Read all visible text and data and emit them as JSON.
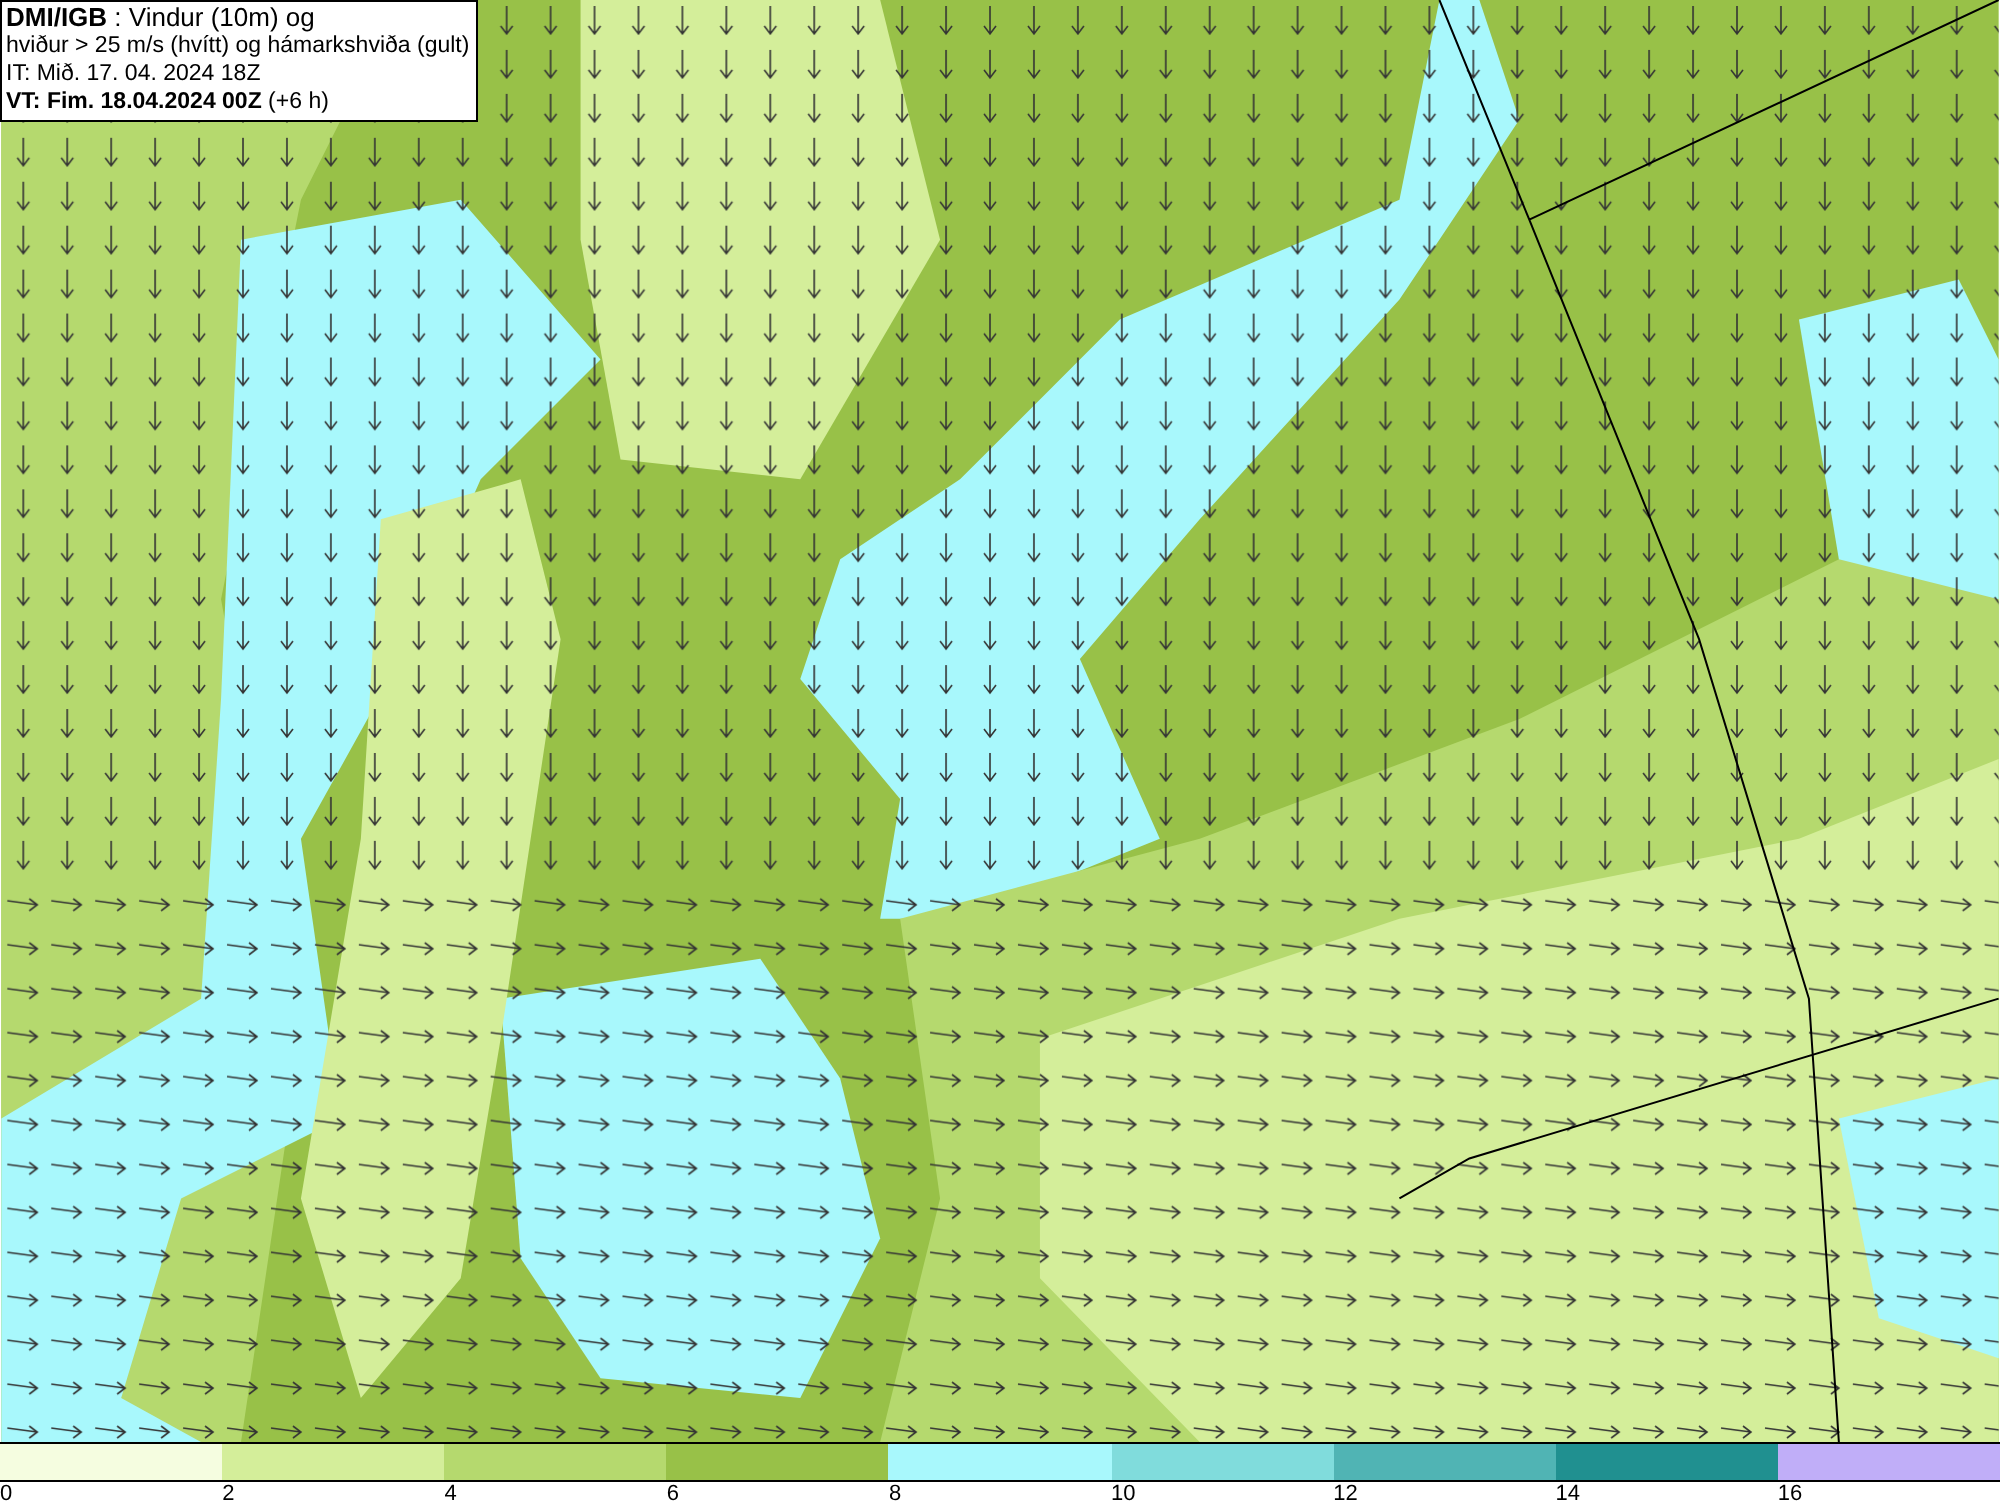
{
  "header": {
    "lines": [
      "**DMI/IGB** : Vindur (10m) og",
      "hviður > 25 m/s (hvítt) og hámarkshviða (gult)",
      "IT: Mið. 17. 04. 2024 18Z",
      "**VT: Fim. 18.04.2024 00Z** (+6 h)"
    ]
  },
  "legend": {
    "bins": [
      {
        "color": "#f5fde0"
      },
      {
        "color": "#d4ee9a"
      },
      {
        "color": "#b5d96e"
      },
      {
        "color": "#98c148"
      },
      {
        "color": "#a8f8fc"
      },
      {
        "color": "#80dcdc"
      },
      {
        "color": "#50b4b4"
      },
      {
        "color": "#209090"
      },
      {
        "color": "#c0aef8"
      }
    ],
    "ticks": [
      "0",
      "2",
      "4",
      "6",
      "8",
      "10",
      "12",
      "14",
      "16"
    ]
  }
}
